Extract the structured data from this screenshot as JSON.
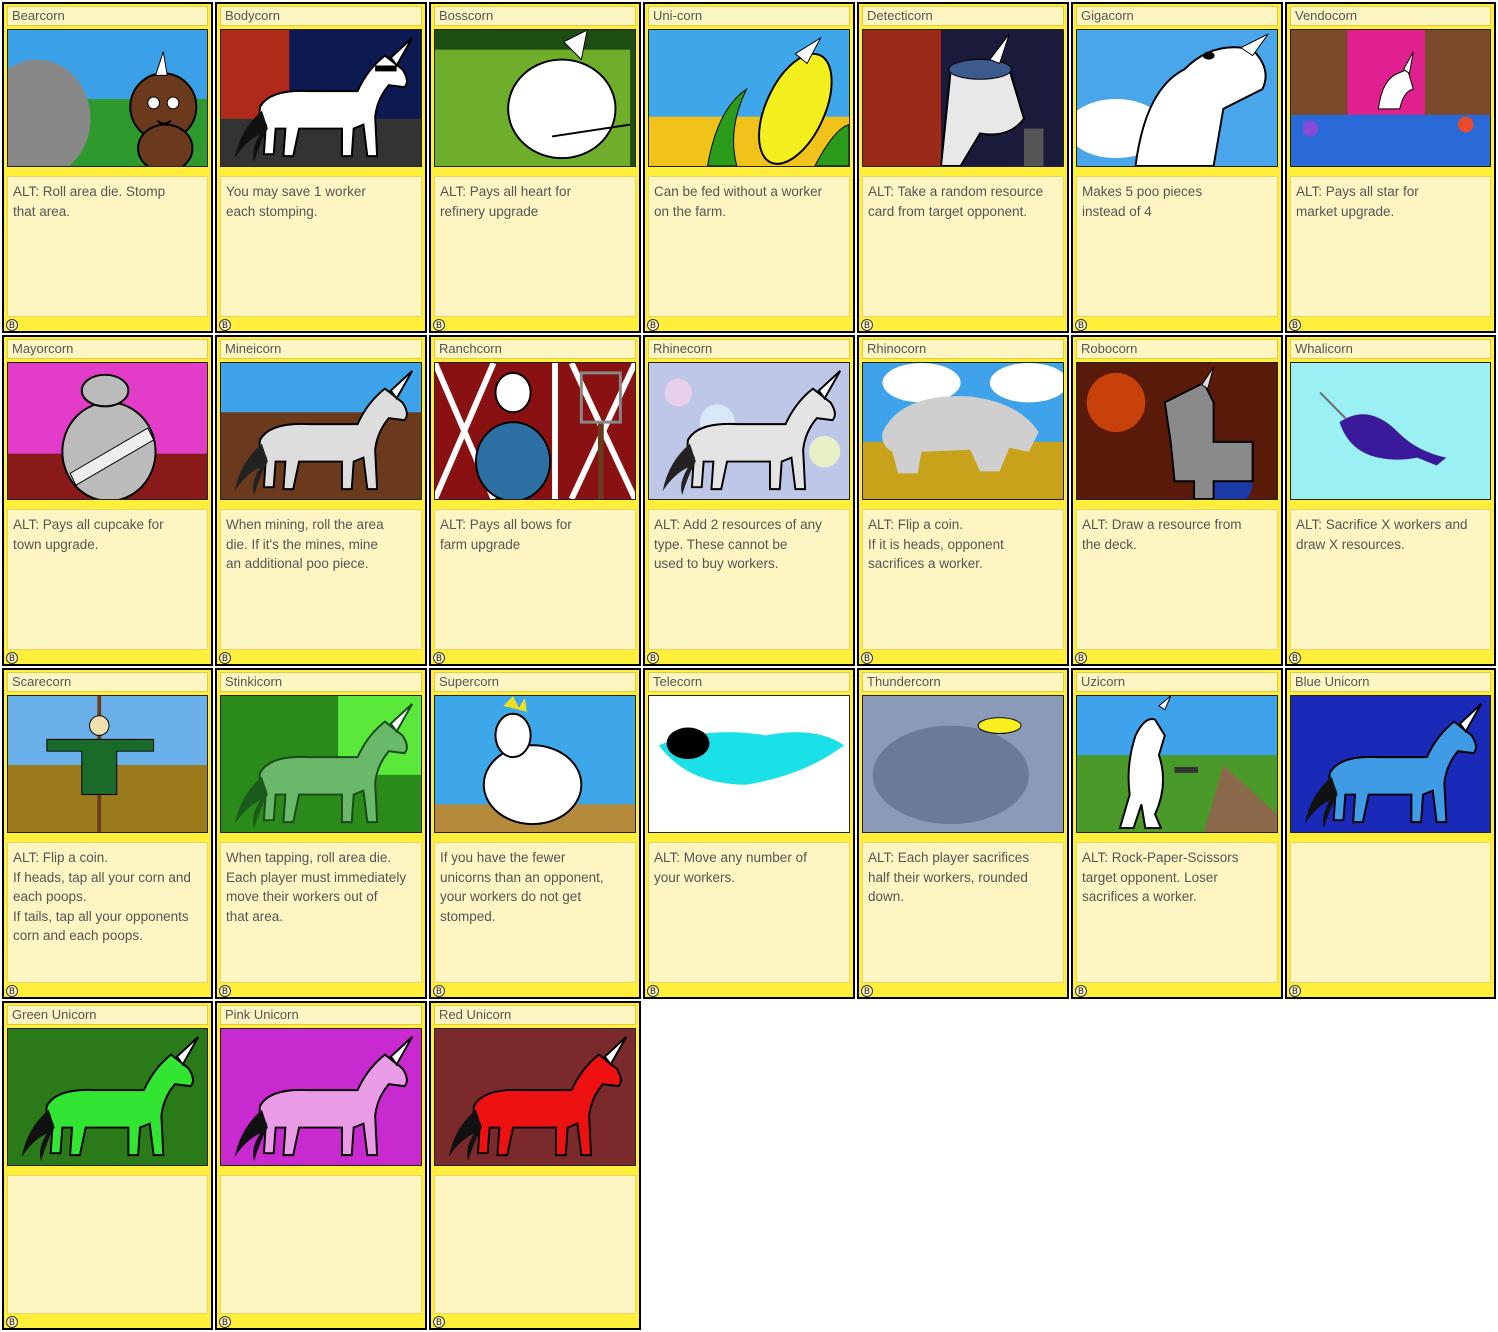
{
  "cards": [
    {
      "name": "Bearcorn",
      "text": "ALT: Roll area die.  Stomp\nthat area.",
      "icon": "bear-unicorn-icon",
      "badge": "B"
    },
    {
      "name": "Bodycorn",
      "text": "You may save 1 worker\neach stomping.",
      "icon": "muscle-unicorn-icon",
      "badge": "B"
    },
    {
      "name": "Bosscorn",
      "text": "ALT: Pays all heart for\nrefinery upgrade",
      "icon": "boss-unicorn-icon",
      "badge": "B"
    },
    {
      "name": "Uni-corn",
      "text": "Can be fed without a worker\non the farm.",
      "icon": "corn-icon",
      "badge": "B"
    },
    {
      "name": "Detecticorn",
      "text": "ALT: Take a random resource\ncard from target opponent.",
      "icon": "detective-unicorn-icon",
      "badge": "B"
    },
    {
      "name": "Gigacorn",
      "text": "Makes 5 poo pieces\ninstead of 4",
      "icon": "giant-unicorn-icon",
      "badge": "B"
    },
    {
      "name": "Vendocorn",
      "text": "ALT: Pays all star for\nmarket upgrade.",
      "icon": "vendor-unicorn-icon",
      "badge": "B"
    },
    {
      "name": "Mayorcorn",
      "text": "ALT: Pays all cupcake for\ntown upgrade.",
      "icon": "mayor-unicorn-icon",
      "badge": "B"
    },
    {
      "name": "Mineicorn",
      "text": "When mining, roll the area\ndie.  If it's the mines, mine\nan additional poo piece.",
      "icon": "mining-unicorn-icon",
      "badge": "B"
    },
    {
      "name": "Ranchcorn",
      "text": "ALT: Pays all bows for\nfarm upgrade",
      "icon": "farmer-unicorn-icon",
      "badge": "B"
    },
    {
      "name": "Rhinecorn",
      "text": "ALT: Add 2 resources of any\ntype.  These cannot be\nused to buy workers.",
      "icon": "rhinestone-unicorn-icon",
      "badge": "B"
    },
    {
      "name": "Rhinocorn",
      "text": "ALT: Flip a coin.\nIf it is heads, opponent\nsacrifices a worker.",
      "icon": "rhino-icon",
      "badge": "B"
    },
    {
      "name": "Robocorn",
      "text": "ALT: Draw a resource from\nthe deck.",
      "icon": "robot-unicorn-icon",
      "badge": "B"
    },
    {
      "name": "Whalicorn",
      "text": "ALT: Sacrifice X workers and\ndraw X resources.",
      "icon": "narwhal-icon",
      "badge": "B"
    },
    {
      "name": "Scarecorn",
      "text": "ALT: Flip a coin.\nIf heads, tap all your corn and\neach poops.\nIf tails, tap all your opponents\ncorn and each poops.",
      "icon": "scarecrow-icon",
      "badge": "B"
    },
    {
      "name": "Stinkicorn",
      "text": "When tapping, roll area die.\nEach player must immediately\nmove their workers out of\nthat area.",
      "icon": "stinky-unicorn-icon",
      "badge": "B"
    },
    {
      "name": "Supercorn",
      "text": "If you have the fewer\nunicorns than an opponent,\nyour workers do not get\nstomped.",
      "icon": "super-unicorn-icon",
      "badge": "B"
    },
    {
      "name": "Telecorn",
      "text": "ALT: Move any number of\nyour workers.",
      "icon": "teleport-icon",
      "badge": "B"
    },
    {
      "name": "Thundercorn",
      "text": "ALT: Each player sacrifices\nhalf their workers, rounded\ndown.",
      "icon": "storm-cloud-icon",
      "badge": "B"
    },
    {
      "name": "Uzicorn",
      "text": "ALT: Rock-Paper-Scissors\ntarget opponent.  Loser\nsacrifices a worker.",
      "icon": "armed-unicorn-icon",
      "badge": "B"
    },
    {
      "name": "Blue Unicorn",
      "text": "",
      "icon": "blue-unicorn-icon",
      "badge": "B"
    },
    {
      "name": "Green Unicorn",
      "text": "",
      "icon": "green-unicorn-icon",
      "badge": "B"
    },
    {
      "name": "Pink Unicorn",
      "text": "",
      "icon": "pink-unicorn-icon",
      "badge": "B"
    },
    {
      "name": "Red Unicorn",
      "text": "",
      "icon": "red-unicorn-icon",
      "badge": "B"
    }
  ],
  "colors": {
    "card_border": "#ffef3a",
    "text_panel": "#fdf6c2",
    "blue": "#3f9be6",
    "green": "#33e533",
    "pink": "#e99be6",
    "red": "#ee1111"
  }
}
